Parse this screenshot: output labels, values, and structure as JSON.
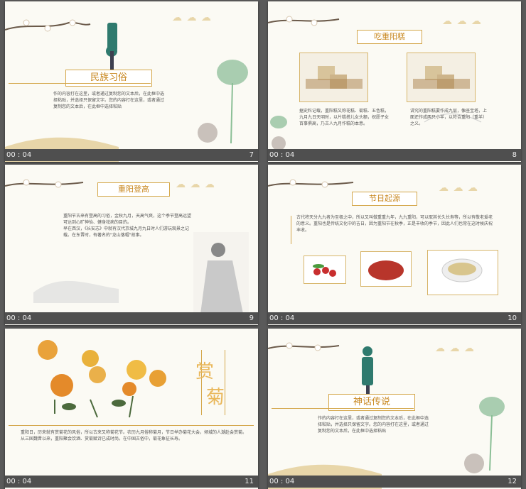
{
  "slides": [
    {
      "title": "民族习俗",
      "body": "作的内容打在这里，或者通过复制您的文本后，在此框中选择粘贴，并选择只保留文字。您的内容打在这里，或者通过复制您的文本后，在此框中选择粘贴",
      "footer_label": "00 : 04",
      "number": "7"
    },
    {
      "title": "吃重阳糕",
      "body_left": "据史料记载，重阳糕又称花糕、菊糕、五色糕，九月九日天明时，以片糕搭儿女头额，祝愿子女百事俱高，乃古人九月作糕的本意。",
      "body_right": "讲究的重阳糕要作成九层，像座宝塔，上面还作成两只小羊，以符合重阳（重羊）之义。",
      "footer_label": "00 : 04",
      "number": "8"
    },
    {
      "title": "重阳登高",
      "body": "重阳节古来有登高的习俗，金秋九月，天高气爽，这个季节登高远望可达到心旷神怡、健身祛病的目的。\n早在西汉，《长安志》中就有汉代京城九月九日时人们游玩观景之记载。在东晋时，有著名的\"龙山落帽\"故事。",
      "footer_label": "00 : 04",
      "number": "9"
    },
    {
      "title": "节日起源",
      "body": "古代将天分九九者为至极之中，所以又叫做重重九年，九九重阳，可以取其长久长寿等，所以有敬老爱老的意义。重阳也是传统文化中的吉日，因为重阳节在秋季，正是丰收的季节，因此人们也常在这时候庆祝丰收。",
      "footer_label": "00 : 04",
      "number": "10"
    },
    {
      "title_char1": "赏",
      "title_char2": "菊",
      "body": "重阳日，历来就有赏菊花的风俗，所以古来又称菊花节。农历九月俗称菊月，节日举办菊花大会，倾城的人潮赴会赏菊。从三国魏晋以来，重阳聚会饮酒、赏菊赋诗已成时尚。在中国古俗中，菊花象征长寿。",
      "footer_label": "00 : 04",
      "number": "11"
    },
    {
      "title": "神话传说",
      "body": "作的内容打在这里，或者通过复制您的文本后，在此框中选择粘贴，并选择只保留文字。您的内容打在这里，或者通过复制您的文本后，在此框中选择粘贴",
      "footer_label": "00 : 04",
      "number": "12"
    }
  ],
  "colors": {
    "accent": "#c8871f",
    "border": "#d4a74b",
    "background": "#5a5a5a",
    "slide": "#fbfaf4"
  }
}
